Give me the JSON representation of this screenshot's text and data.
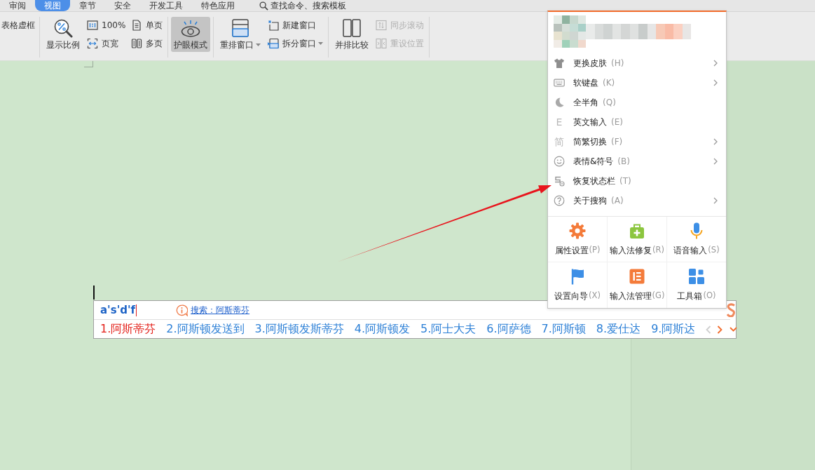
{
  "ribbon_tabs": [
    {
      "label": "审阅",
      "selected": false
    },
    {
      "label": "视图",
      "selected": true
    },
    {
      "label": "章节",
      "selected": false
    },
    {
      "label": "安全",
      "selected": false
    },
    {
      "label": "开发工具",
      "selected": false
    },
    {
      "label": "特色应用",
      "selected": false
    }
  ],
  "command_search": {
    "placeholder": "查找命令、搜索模板"
  },
  "toolbar": {
    "groups": [
      {
        "items": [
          {
            "kind": "stack",
            "items": [
              {
                "label": "表格虚框",
                "on": false,
                "disabled": false,
                "dropdown": false
              }
            ]
          }
        ]
      },
      {
        "items": [
          {
            "kind": "large",
            "label": "显示比例",
            "on": false,
            "disabled": false,
            "dropdown": false
          },
          {
            "kind": "stack",
            "items": [
              {
                "label": "100%",
                "on": false,
                "disabled": false,
                "dropdown": false
              },
              {
                "label": "页宽",
                "on": false,
                "disabled": false,
                "dropdown": false
              }
            ]
          },
          {
            "kind": "stack",
            "items": [
              {
                "label": "单页",
                "on": false,
                "disabled": false,
                "dropdown": false
              },
              {
                "label": "多页",
                "on": false,
                "disabled": false,
                "dropdown": false
              }
            ]
          }
        ]
      },
      {
        "items": [
          {
            "kind": "large",
            "label": "护眼模式",
            "on": true,
            "disabled": false,
            "dropdown": false
          }
        ]
      },
      {
        "items": [
          {
            "kind": "large",
            "label": "重排窗口",
            "on": false,
            "disabled": false,
            "dropdown": true
          },
          {
            "kind": "stack",
            "items": [
              {
                "label": "新建窗口",
                "on": false,
                "disabled": false,
                "dropdown": false
              },
              {
                "label": "拆分窗口",
                "on": false,
                "disabled": false,
                "dropdown": true
              }
            ]
          }
        ]
      },
      {
        "items": [
          {
            "kind": "large",
            "label": "并排比较",
            "on": false,
            "disabled": false,
            "dropdown": false
          },
          {
            "kind": "stack",
            "items": [
              {
                "label": "同步滚动",
                "on": false,
                "disabled": true,
                "dropdown": false
              },
              {
                "label": "重设位置",
                "on": false,
                "disabled": true,
                "dropdown": false
              }
            ]
          }
        ]
      }
    ]
  },
  "ime_menu": {
    "items": [
      {
        "label": "更换皮肤",
        "shortcut": "(H)",
        "submenu": true
      },
      {
        "label": "软键盘",
        "shortcut": "(K)",
        "submenu": true
      },
      {
        "label": "全半角",
        "shortcut": "(Q)",
        "submenu": false
      },
      {
        "label": "英文输入",
        "shortcut": "(E)",
        "submenu": false,
        "icon_text": "E"
      },
      {
        "label": "简繁切换",
        "shortcut": "(F)",
        "submenu": true,
        "icon_text": "简"
      },
      {
        "label": "表情&符号",
        "shortcut": "(B)",
        "submenu": true
      },
      {
        "label": "恢复状态栏",
        "shortcut": "(T)",
        "submenu": false
      },
      {
        "label": "关于搜狗",
        "shortcut": "(A)",
        "submenu": true
      }
    ],
    "tools": [
      {
        "label": "属性设置",
        "shortcut": "(P)"
      },
      {
        "label": "输入法修复",
        "shortcut": "(R)"
      },
      {
        "label": "语音输入",
        "shortcut": "(S)"
      },
      {
        "label": "设置向导",
        "shortcut": "(X)"
      },
      {
        "label": "输入法管理",
        "shortcut": "(G)"
      },
      {
        "label": "工具箱",
        "shortcut": "(O)"
      }
    ]
  },
  "ime_bar": {
    "composition": "a's'd'f",
    "search_link": "搜索：阿斯蒂芬",
    "candidates": [
      {
        "text": "1.阿斯蒂芬",
        "selected": true
      },
      {
        "text": "2.阿斯顿发送到",
        "selected": false
      },
      {
        "text": "3.阿斯顿发斯蒂芬",
        "selected": false
      },
      {
        "text": "4.阿斯顿发",
        "selected": false
      },
      {
        "text": "5.阿士大夫",
        "selected": false
      },
      {
        "text": "6.阿萨德",
        "selected": false
      },
      {
        "text": "7.阿斯顿",
        "selected": false
      },
      {
        "text": "8.爱仕达",
        "selected": false
      },
      {
        "text": "9.阿斯达",
        "selected": false
      }
    ],
    "paging": {
      "prev_enabled": false,
      "next_enabled": true
    }
  }
}
